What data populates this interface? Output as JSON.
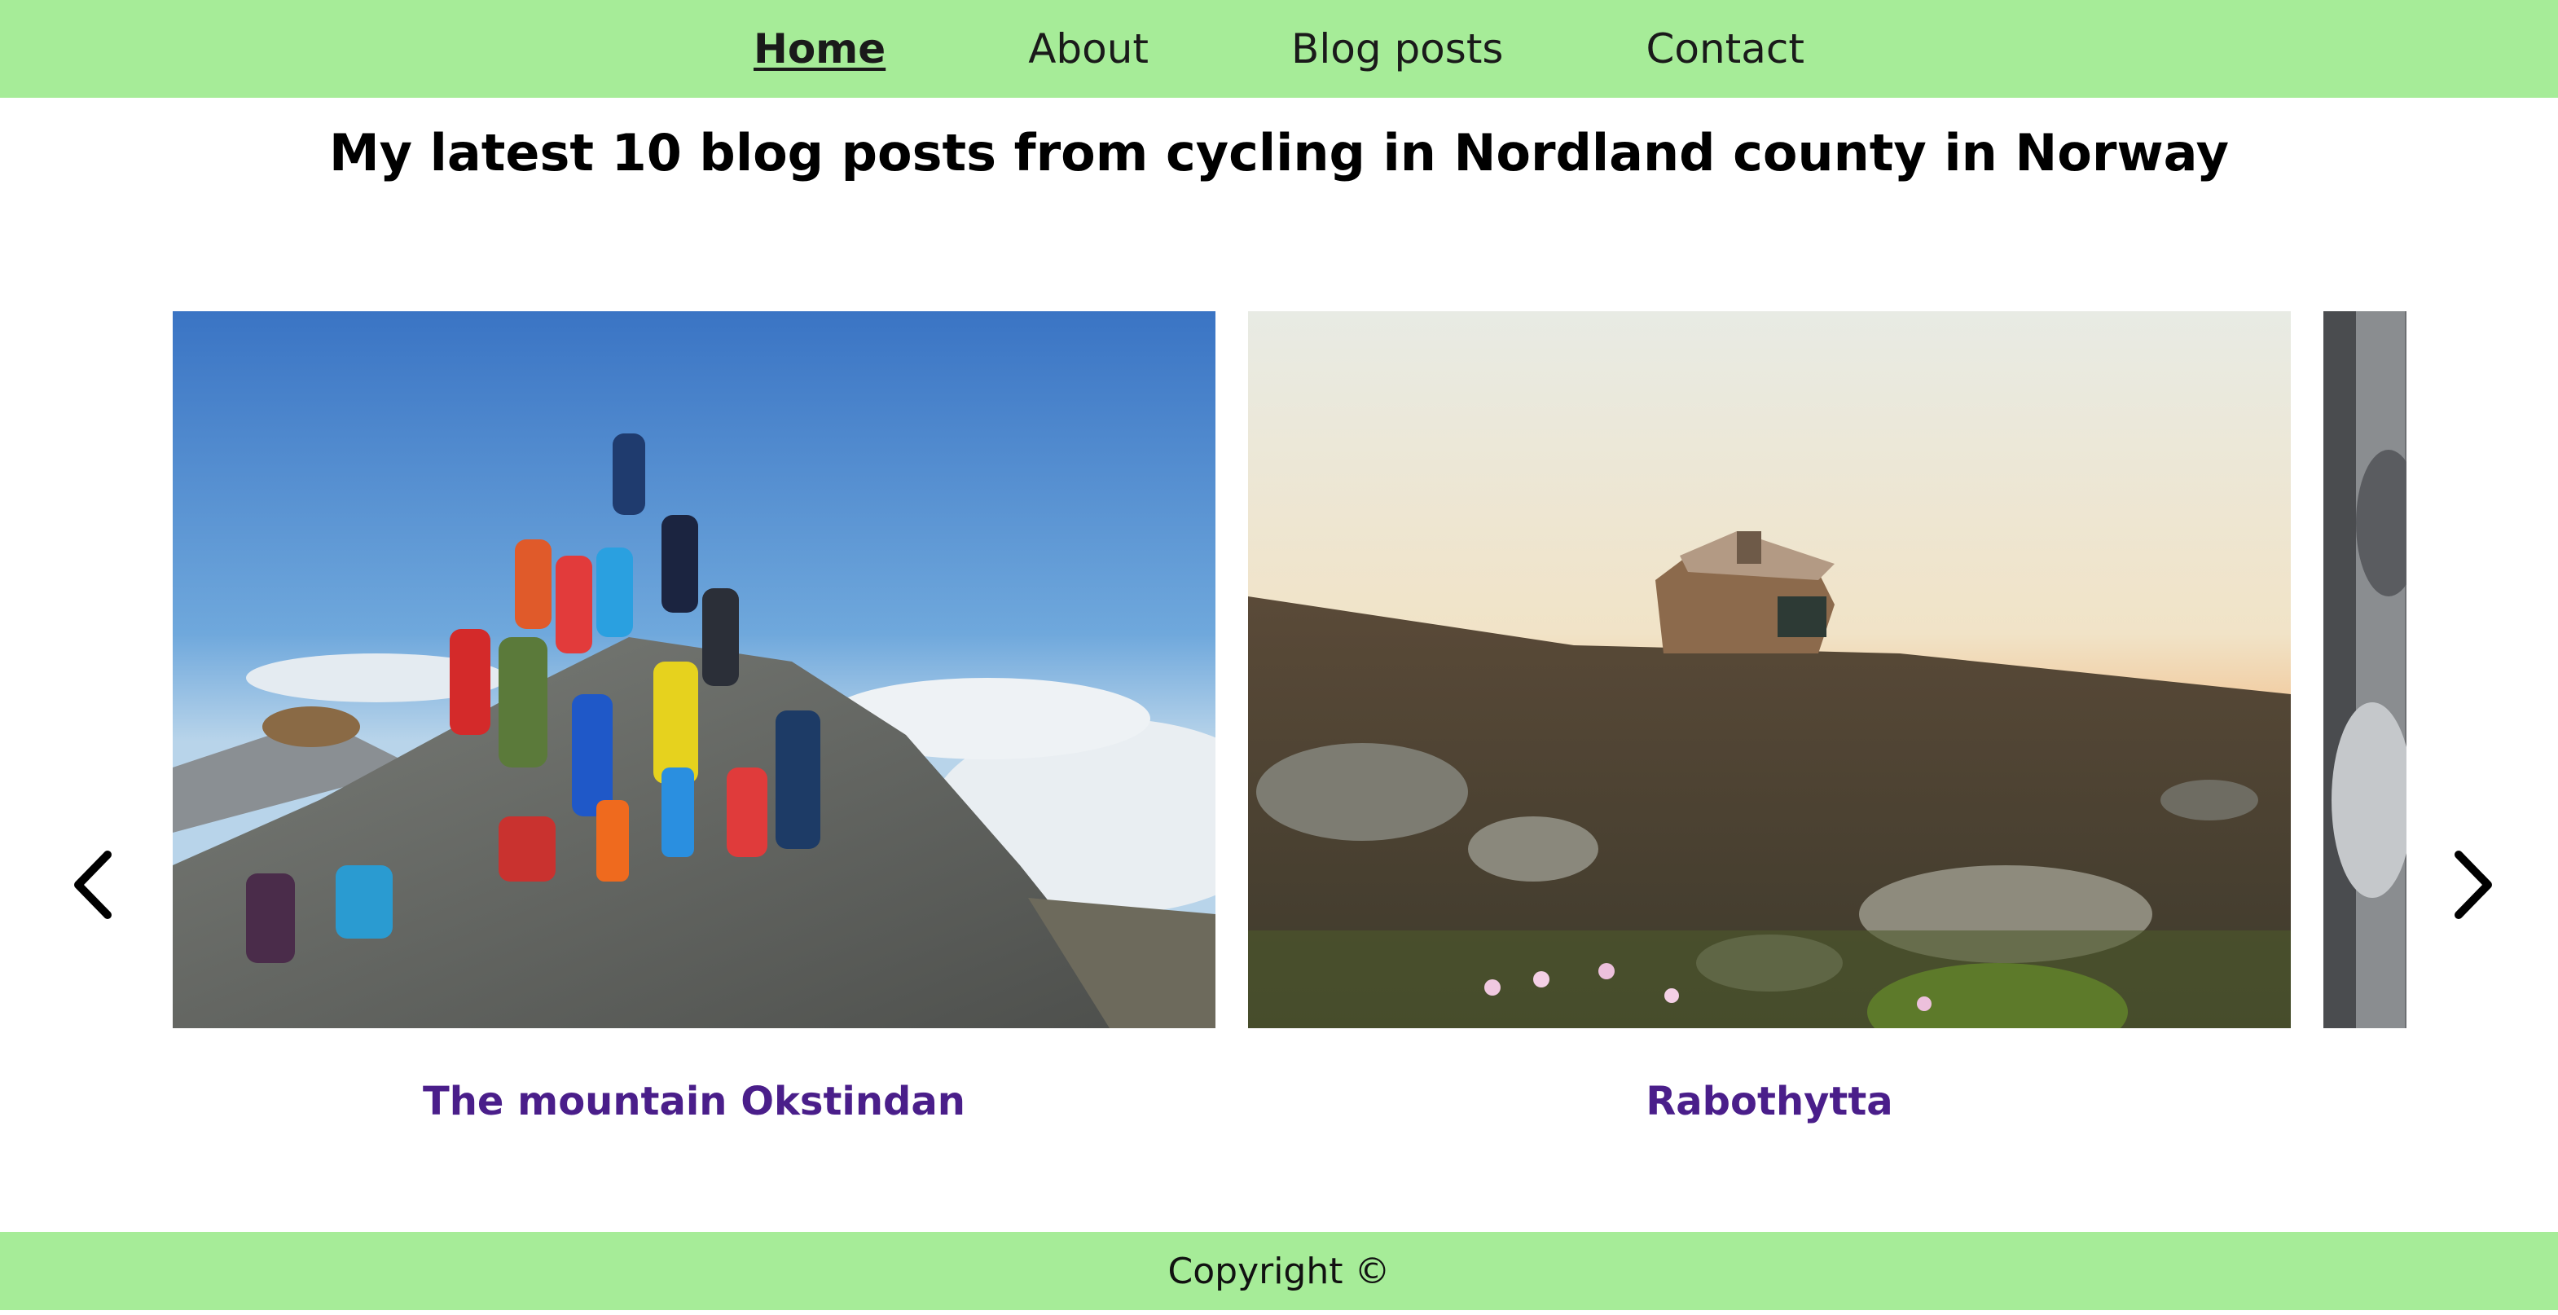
{
  "nav": {
    "items": [
      {
        "label": "Home",
        "active": true
      },
      {
        "label": "About",
        "active": false
      },
      {
        "label": "Blog posts",
        "active": false
      },
      {
        "label": "Contact",
        "active": false
      }
    ]
  },
  "page_title": "My latest 10 blog posts from cycling in Nordland county in Norway",
  "carousel": {
    "prev_icon": "chevron-left-icon",
    "next_icon": "chevron-right-icon",
    "slides": [
      {
        "caption": "The mountain Okstindan￼",
        "image": "group-of-hikers-on-mountain-summit"
      },
      {
        "caption": "Rabothytta￼",
        "image": "mountain-cabin-at-sunset"
      },
      {
        "caption": "",
        "image": "grey-rock-partial"
      }
    ]
  },
  "footer": {
    "copyright": "Copyright ©"
  },
  "colors": {
    "nav_bg": "#a6ec98",
    "footer_bg": "#a6ec98",
    "caption_link": "#4a1e8a"
  }
}
